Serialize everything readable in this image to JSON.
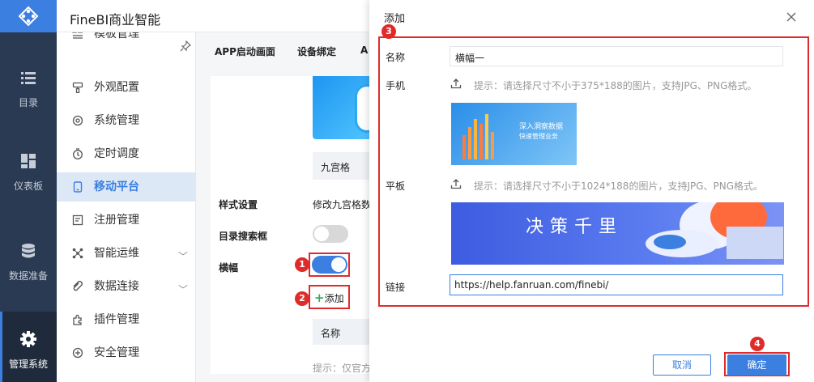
{
  "app": {
    "title": "FineBI商业智能"
  },
  "nav": {
    "items": [
      {
        "label": "目录",
        "icon": "list-icon"
      },
      {
        "label": "仪表板",
        "icon": "dashboard-icon"
      },
      {
        "label": "数据准备",
        "icon": "database-icon"
      },
      {
        "label": "管理系统",
        "icon": "gear-icon",
        "active": true
      }
    ]
  },
  "submenu": {
    "items": [
      {
        "label": "模板管理",
        "icon": "template-icon"
      },
      {
        "label": "外观配置",
        "icon": "brush-icon"
      },
      {
        "label": "系统管理",
        "icon": "gear-icon"
      },
      {
        "label": "定时调度",
        "icon": "timer-icon"
      },
      {
        "label": "移动平台",
        "icon": "mobile-icon",
        "active": true
      },
      {
        "label": "注册管理",
        "icon": "register-icon"
      },
      {
        "label": "智能运维",
        "icon": "ops-icon",
        "chevron": "﹀"
      },
      {
        "label": "数据连接",
        "icon": "link-icon",
        "chevron": "﹀"
      },
      {
        "label": "插件管理",
        "icon": "plugin-icon"
      },
      {
        "label": "安全管理",
        "icon": "shield-icon"
      }
    ]
  },
  "tabs": [
    "APP启动画面",
    "设备绑定",
    "A"
  ],
  "settings": {
    "grid_label": "九宫格",
    "style_label": "样式设置",
    "style_value": "修改九宫格数",
    "search_label": "目录搜索框",
    "banner_label": "横幅",
    "add_label": "添加",
    "name_col": "名称",
    "hint_text": "提示：仅官方"
  },
  "modal": {
    "title": "添加",
    "name_label": "名称",
    "name_value": "横幅一",
    "phone_label": "手机",
    "phone_hint": "提示：请选择尺寸不小于375*188的图片，支持JPG、PNG格式。",
    "phone_img_line1": "深入洞察数据",
    "phone_img_line2": "快速管理业务",
    "tablet_label": "平板",
    "tablet_hint": "提示：请选择尺寸不小于1024*188的图片，支持JPG、PNG格式。",
    "tablet_img_text": "决策千里",
    "link_label": "链接",
    "link_value": "https://help.fanruan.com/finebi/",
    "cancel": "取消",
    "confirm": "确定"
  },
  "badges": [
    "1",
    "2",
    "3",
    "4"
  ],
  "colors": {
    "accent": "#3b7fe0",
    "nav_bg": "#2a3a52",
    "highlight": "#e02b2b",
    "toggle_on": "#3b7fe0",
    "toggle_off": "#d8d8d8"
  }
}
